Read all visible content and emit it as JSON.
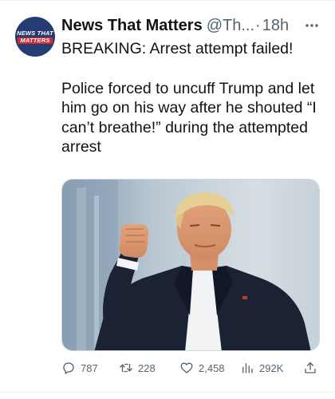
{
  "author": {
    "avatar_line1": "NEWS THAT",
    "avatar_line2": "MATTERS",
    "name": "News That Matters",
    "handle": "@Th...",
    "separator": "·",
    "time": "18h"
  },
  "tweet": {
    "paragraph1": "BREAKING: Arrest attempt failed!",
    "paragraph2": "Police forced to uncuff Trump and let him go on his way after he shouted “I can’t breathe!” during the attempted arrest"
  },
  "actions": {
    "replies": "787",
    "retweets": "228",
    "likes": "2,458",
    "views": "292K"
  },
  "icons": {
    "more": "more-icon",
    "reply": "reply-icon",
    "retweet": "retweet-icon",
    "like": "heart-icon",
    "views": "views-icon",
    "share": "share-icon"
  },
  "colors": {
    "text": "#0f1419",
    "secondary": "#536471",
    "avatar_bg": "#243b73",
    "avatar_accent": "#d52b2b"
  }
}
